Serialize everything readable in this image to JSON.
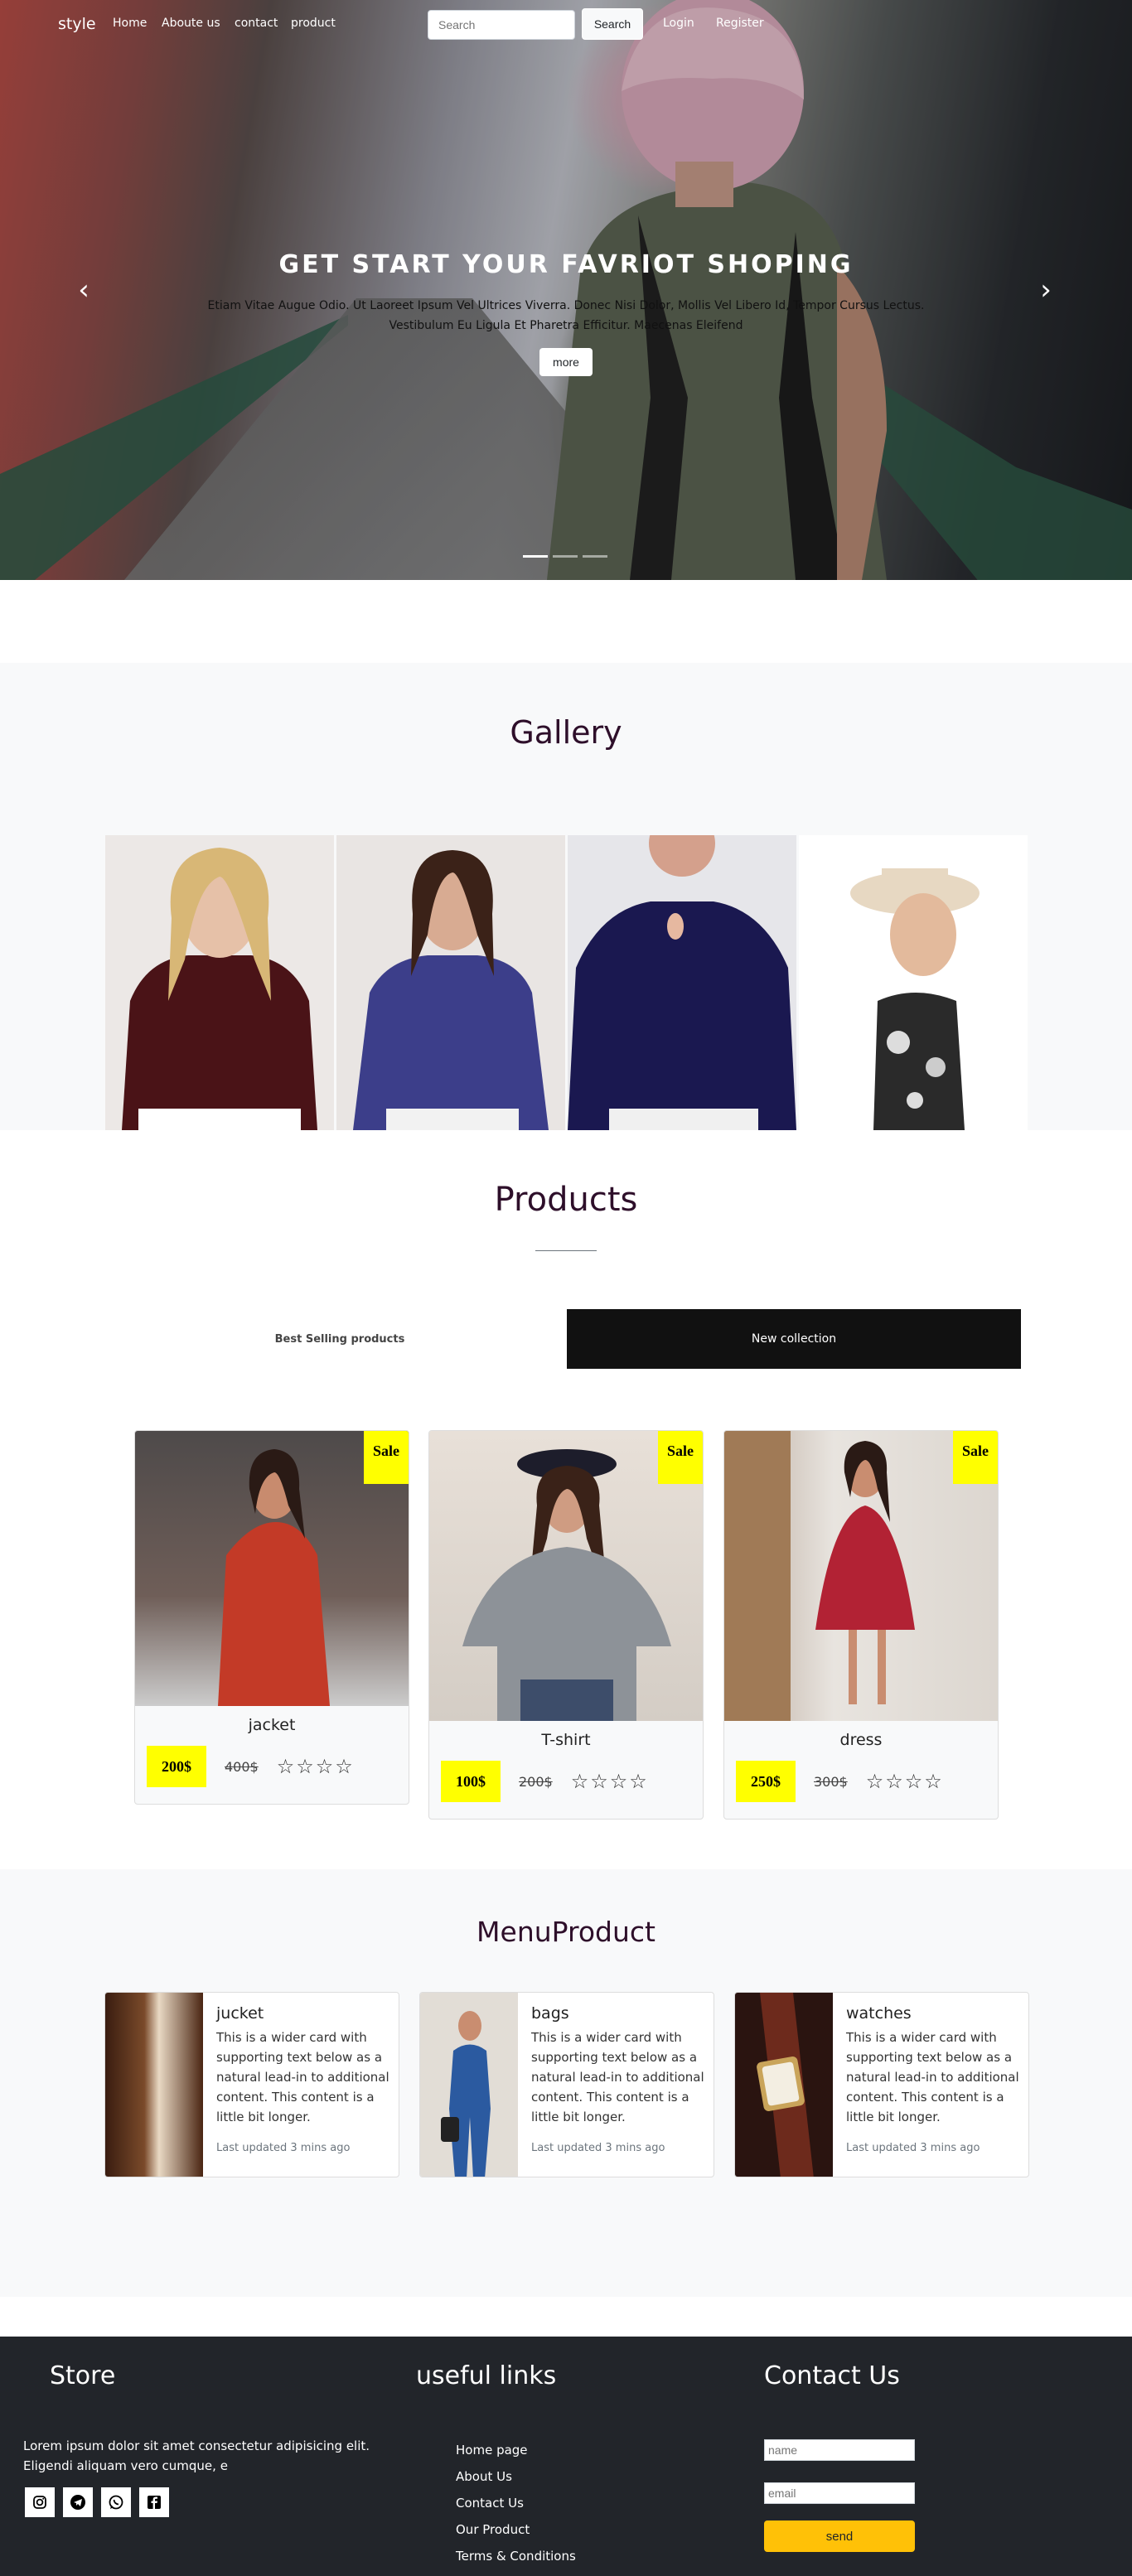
{
  "nav": {
    "brand": "style",
    "links": [
      "Home",
      "Aboute us",
      "contact",
      "product"
    ],
    "search_placeholder": "Search",
    "search_button": "Search",
    "login": "Login",
    "register": "Register"
  },
  "hero": {
    "title": "GET START YOUR FAVRIOT SHOPING",
    "text_line1": "Etiam Vitae Augue Odio. Ut Laoreet Ipsum Vel Ultrices Viverra. Donec Nisi Dolor, Mollis Vel Libero Id, Tempor Cursus Lectus.",
    "text_line2": "Vestibulum Eu Ligula Et Pharetra Efficitur. Maecenas Eleifend",
    "more_button": "more",
    "prev_arrow": "‹",
    "next_arrow": "›"
  },
  "gallery": {
    "title": "Gallery"
  },
  "products": {
    "title": "Products",
    "tab_best": "Best Selling products",
    "tab_new": "New collection",
    "sale_label": "Sale",
    "stars": "☆☆☆☆",
    "items": [
      {
        "name": "jacket",
        "price": "200$",
        "old_price": "400$"
      },
      {
        "name": "T-shirt",
        "price": "100$",
        "old_price": "200$"
      },
      {
        "name": "dress",
        "price": "250$",
        "old_price": "300$"
      }
    ]
  },
  "menu_product": {
    "title": "MenuProduct",
    "items": [
      {
        "name": "jucket",
        "text": "This is a wider card with supporting text below as a natural lead-in to additional content. This content is a little bit longer.",
        "updated": "Last updated 3 mins ago"
      },
      {
        "name": "bags",
        "text": "This is a wider card with supporting text below as a natural lead-in to additional content. This content is a little bit longer.",
        "updated": "Last updated 3 mins ago"
      },
      {
        "name": "watches",
        "text": "This is a wider card with supporting text below as a natural lead-in to additional content. This content is a little bit longer.",
        "updated": "Last updated 3 mins ago"
      }
    ]
  },
  "footer": {
    "store_heading": "Store",
    "store_text_line1": "Lorem ipsum dolor sit amet consectetur adipisicing elit.",
    "store_text_line2": "Eligendi aliquam vero cumque, e",
    "social_icons": [
      "instagram-icon",
      "telegram-icon",
      "whatsapp-icon",
      "facebook-icon"
    ],
    "links_heading": "useful links",
    "links": [
      "Home page",
      "About Us",
      "Contact Us",
      "Our Product",
      "Terms & Conditions"
    ],
    "contact_heading": "Contact Us",
    "name_placeholder": "name",
    "email_placeholder": "email",
    "send_button": "send"
  },
  "colors": {
    "heading": "#2e0f2a",
    "sale_yellow": "#ffff00",
    "send_button": "#ffc107",
    "footer_bg": "#22252a",
    "section_bg": "#f8f9fa"
  }
}
